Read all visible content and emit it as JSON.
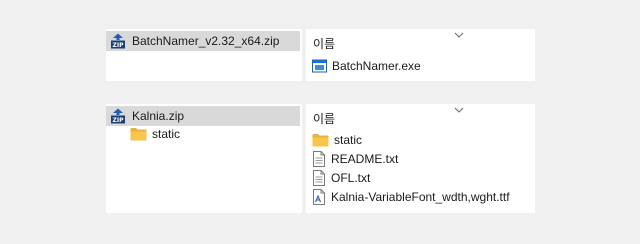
{
  "top": {
    "tree": {
      "archive_label": "BatchNamer_v2.32_x64.zip",
      "archive_icon": "zip-archive-icon"
    },
    "list": {
      "column_header": "이름",
      "files": [
        {
          "name": "BatchNamer.exe",
          "icon": "exe-icon"
        }
      ]
    }
  },
  "bottom": {
    "tree": {
      "archive_label": "Kalnia.zip",
      "archive_icon": "zip-archive-icon",
      "children": [
        {
          "name": "static",
          "icon": "folder-icon"
        }
      ]
    },
    "list": {
      "column_header": "이름",
      "files": [
        {
          "name": "static",
          "icon": "folder-icon"
        },
        {
          "name": "README.txt",
          "icon": "text-file-icon"
        },
        {
          "name": "OFL.txt",
          "icon": "text-file-icon"
        },
        {
          "name": "Kalnia-VariableFont_wdth,wght.ttf",
          "icon": "font-file-icon"
        }
      ]
    }
  },
  "colors": {
    "selected_row": "#d9d9d9",
    "folder": "#f8c64b",
    "zip_blue": "#1f5fb4",
    "exe_blue": "#1e6fd0"
  }
}
